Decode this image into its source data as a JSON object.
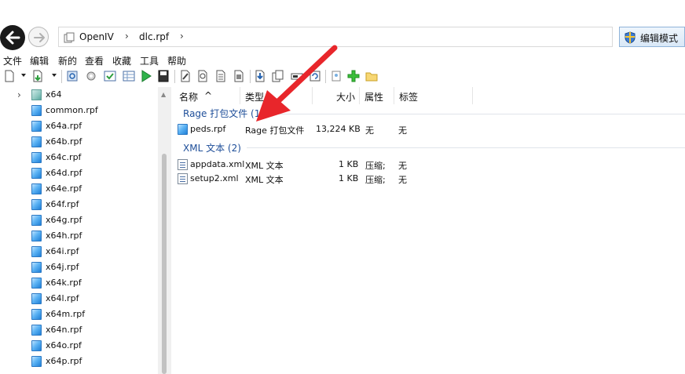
{
  "address": {
    "crumbs": [
      "OpenIV",
      "dlc.rpf"
    ],
    "separator": "›",
    "mode_button": "编辑模式"
  },
  "menu": [
    "文件",
    "编辑",
    "新的",
    "查看",
    "收藏",
    "工具",
    "帮助"
  ],
  "toolbar": {
    "icons": [
      "new-file-icon",
      "export-icon",
      "refresh-icon",
      "settings-icon",
      "check-icon",
      "play-icon",
      "save-icon",
      "edit-icon",
      "search-icon",
      "document-icon",
      "text-icon",
      "import-icon",
      "copy-icon",
      "rename-icon",
      "rebuild-icon",
      "info-icon",
      "add-icon",
      "folder-icon"
    ]
  },
  "tree": {
    "items": [
      {
        "label": "x64",
        "type": "folder",
        "expander": "›"
      },
      {
        "label": "common.rpf",
        "type": "rpf"
      },
      {
        "label": "x64a.rpf",
        "type": "rpf"
      },
      {
        "label": "x64b.rpf",
        "type": "rpf"
      },
      {
        "label": "x64c.rpf",
        "type": "rpf"
      },
      {
        "label": "x64d.rpf",
        "type": "rpf"
      },
      {
        "label": "x64e.rpf",
        "type": "rpf"
      },
      {
        "label": "x64f.rpf",
        "type": "rpf"
      },
      {
        "label": "x64g.rpf",
        "type": "rpf"
      },
      {
        "label": "x64h.rpf",
        "type": "rpf"
      },
      {
        "label": "x64i.rpf",
        "type": "rpf"
      },
      {
        "label": "x64j.rpf",
        "type": "rpf"
      },
      {
        "label": "x64k.rpf",
        "type": "rpf"
      },
      {
        "label": "x64l.rpf",
        "type": "rpf"
      },
      {
        "label": "x64m.rpf",
        "type": "rpf"
      },
      {
        "label": "x64n.rpf",
        "type": "rpf"
      },
      {
        "label": "x64o.rpf",
        "type": "rpf"
      },
      {
        "label": "x64p.rpf",
        "type": "rpf"
      }
    ]
  },
  "list": {
    "columns": [
      "名称",
      "类型",
      "大小",
      "属性",
      "标签"
    ],
    "sort_indicator": "^",
    "groups": [
      {
        "title": "Rage 打包文件 (1)",
        "rows": [
          {
            "name": "peds.rpf",
            "type": "Rage 打包文件",
            "size": "13,224 KB",
            "attr": "无",
            "tag": "无",
            "icon": "rpf"
          }
        ]
      },
      {
        "title": "XML 文本 (2)",
        "rows": [
          {
            "name": "appdata.xml",
            "type": "XML 文本",
            "size": "1 KB",
            "attr": "压缩;",
            "tag": "无",
            "icon": "xml"
          },
          {
            "name": "setup2.xml",
            "type": "XML 文本",
            "size": "1 KB",
            "attr": "压缩;",
            "tag": "无",
            "icon": "xml"
          }
        ]
      }
    ]
  },
  "colors": {
    "group_title": "#1e4e99",
    "arrow": "#e8262b"
  }
}
